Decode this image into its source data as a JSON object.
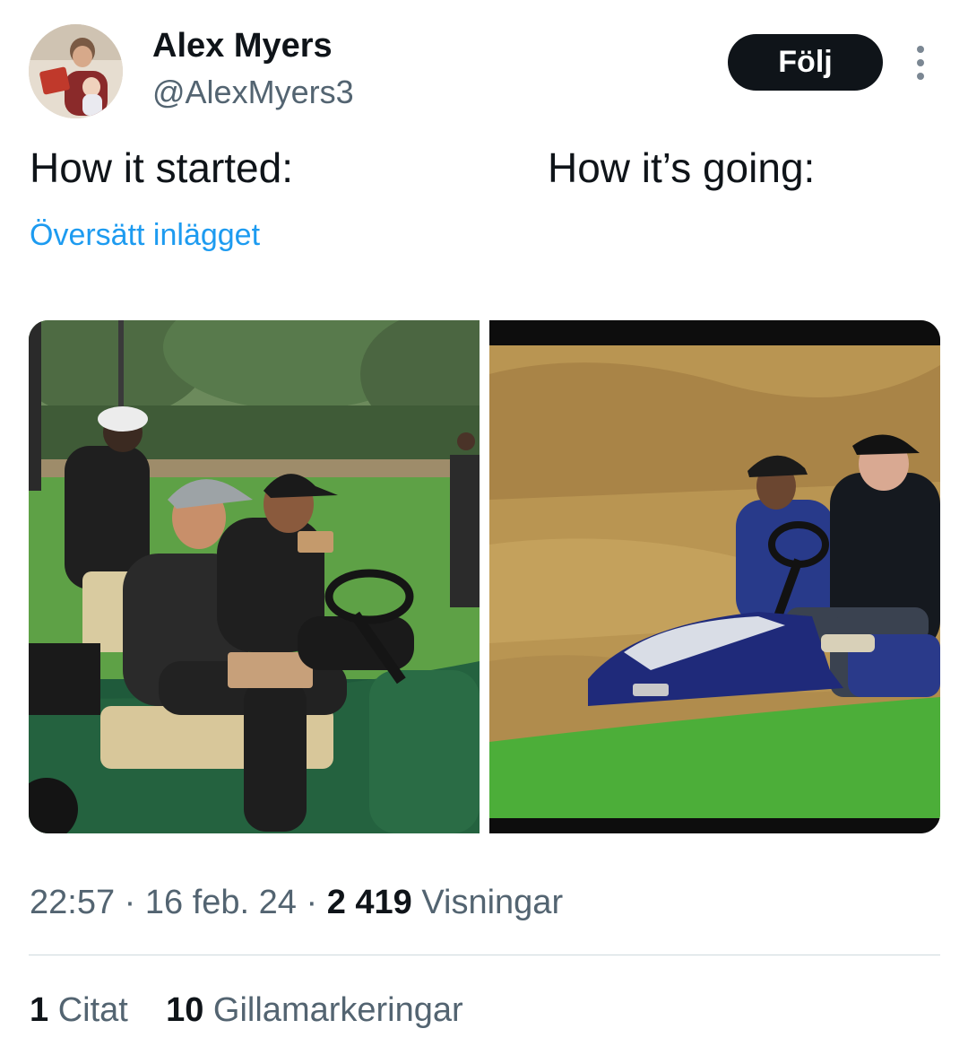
{
  "user": {
    "display_name": "Alex Myers",
    "handle": "@AlexMyers3",
    "avatar_icon": "profile-photo"
  },
  "actions": {
    "follow_label": "Följ",
    "more_icon": "three-dots-vertical-icon"
  },
  "tweet": {
    "text_left": "How it started:",
    "text_right": "How it’s going:",
    "translate_label": "Översätt inlägget"
  },
  "meta": {
    "time": "22:57",
    "separator": "·",
    "date": "16 feb. 24",
    "views_count": "2 419",
    "views_label": "Visningar"
  },
  "stats": {
    "quotes_count": "1",
    "quotes_label": "Citat",
    "likes_count": "10",
    "likes_label": "Gillamarkeringar"
  },
  "colors": {
    "text_primary": "#0f1419",
    "text_secondary": "#536471",
    "link": "#1d9bf0",
    "button_bg": "#0f1419",
    "divider": "#cfd9de"
  }
}
